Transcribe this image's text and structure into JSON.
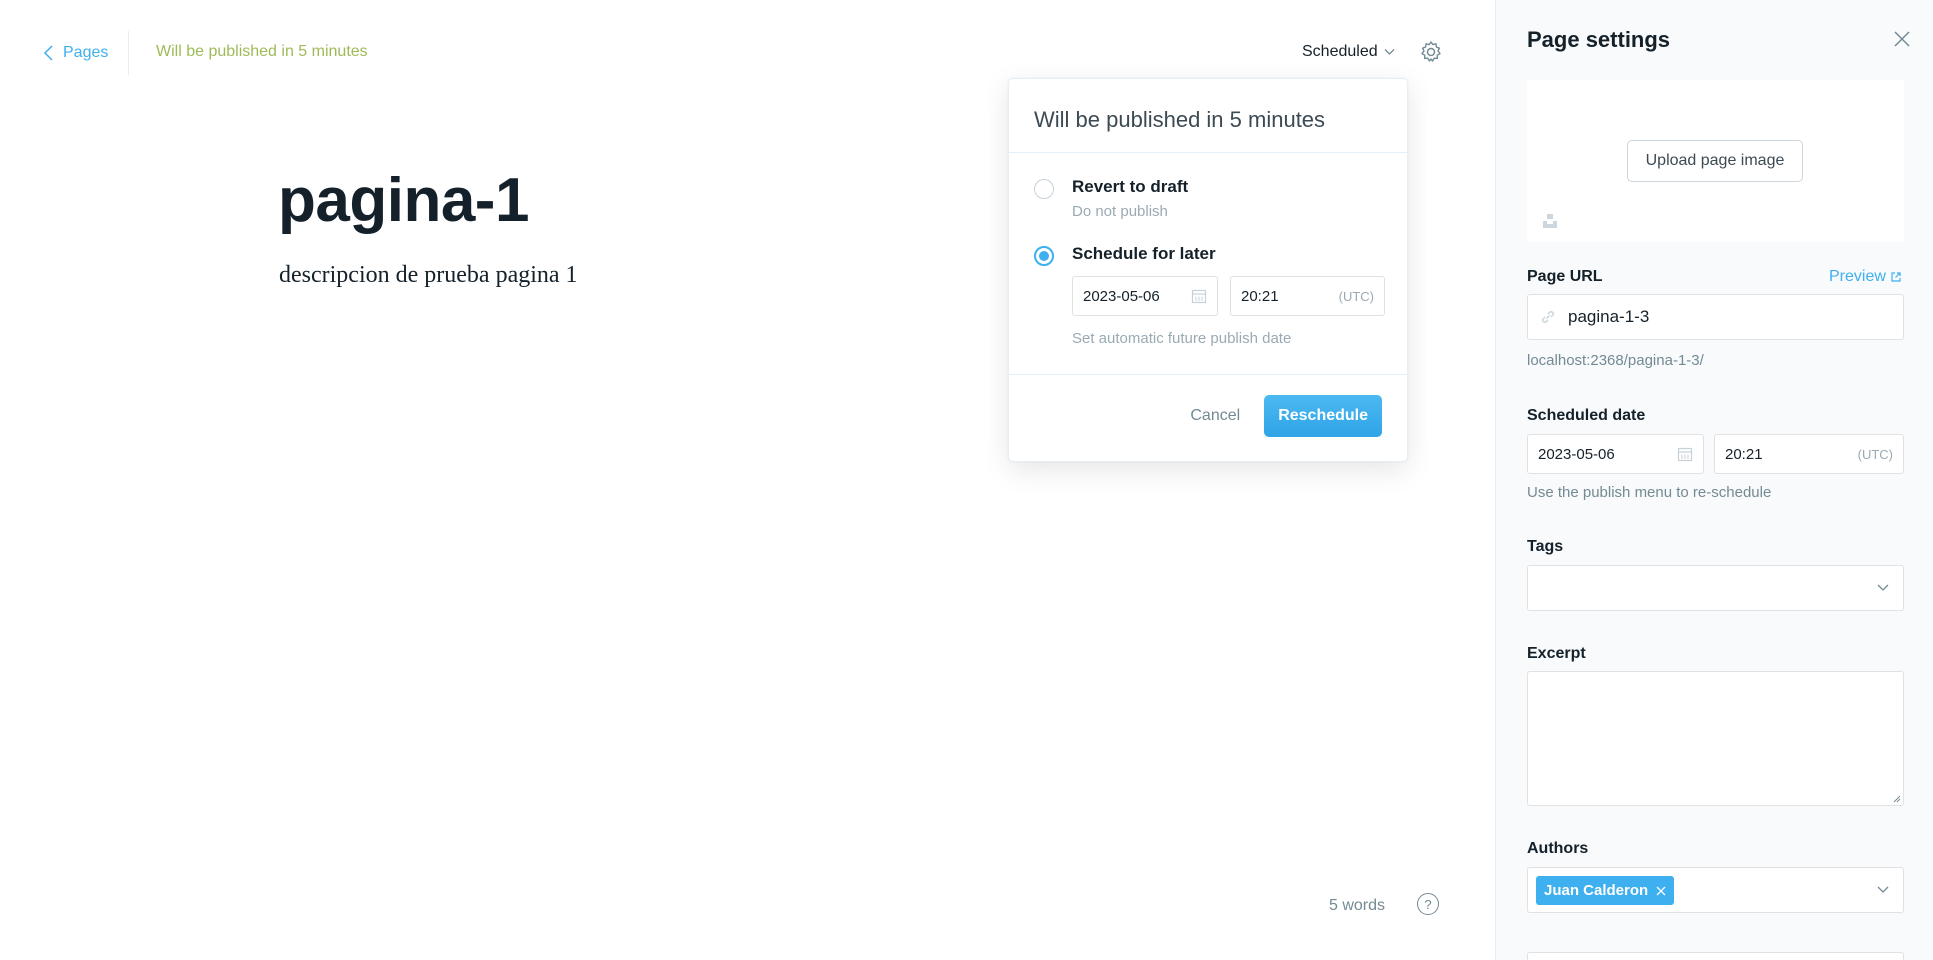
{
  "header": {
    "back_label": "Pages",
    "status": "Will be published in 5 minutes",
    "publish_menu_label": "Scheduled"
  },
  "editor": {
    "title": "pagina-1",
    "description": "descripcion de prueba pagina 1",
    "word_count": "5 words",
    "help_glyph": "?"
  },
  "publish_popover": {
    "title": "Will be published in 5 minutes",
    "options": [
      {
        "label": "Revert to draft",
        "sub": "Do not publish",
        "selected": false
      },
      {
        "label": "Schedule for later",
        "sub": "",
        "selected": true
      }
    ],
    "date": "2023-05-06",
    "time": "20:21",
    "tz": "(UTC)",
    "hint": "Set automatic future publish date",
    "cancel": "Cancel",
    "confirm": "Reschedule"
  },
  "settings": {
    "title": "Page settings",
    "upload_image": "Upload page image",
    "url_label": "Page URL",
    "preview": "Preview",
    "url_value": "pagina-1-3",
    "url_full": "localhost:2368/pagina-1-3/",
    "scheduled_label": "Scheduled date",
    "scheduled_date": "2023-05-06",
    "scheduled_time": "20:21",
    "scheduled_tz": "(UTC)",
    "scheduled_hint": "Use the publish menu to re-schedule",
    "tags_label": "Tags",
    "excerpt_label": "Excerpt",
    "authors_label": "Authors",
    "author": "Juan Calderon"
  },
  "colors": {
    "accent": "#3eb0ef",
    "status_green": "#9fbb58",
    "muted": "#738a94"
  },
  "icons": [
    "chevron-left-icon",
    "chevron-down-icon",
    "gear-icon",
    "close-icon",
    "calendar-icon",
    "link-icon",
    "external-link-icon",
    "unsplash-icon",
    "help-icon"
  ]
}
